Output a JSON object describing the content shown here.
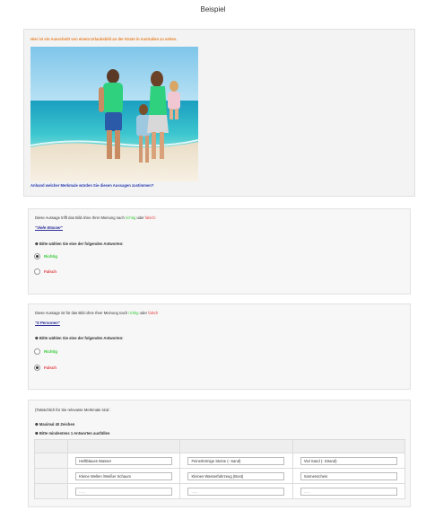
{
  "page": {
    "title": "Beispiel"
  },
  "intro": {
    "text": "Hier ist ein Ausschnitt von einem Urlaubsbild an der Küste in Australien zu sehen.",
    "caption": "Anhand welcher Merkmale würden Sie diesen Aussagen zustimmen?"
  },
  "colors": {
    "orange": "#e8822b",
    "blue": "#2f3fb0",
    "green": "#35c935",
    "red": "#e23a3a"
  },
  "questions": [
    {
      "prompt_prefix": "Diese Aussage trifft das Bild ohne Ihrer Meinung nach",
      "word_true": "richtig",
      "word_or": "oder",
      "word_false": "falsch:",
      "statement": "\"Viele Wasser\"",
      "instruction": "❶ Bitte wählen Sie eine der folgenden Antworten:",
      "options": [
        "Richtig",
        "Falsch"
      ],
      "selected": "Richtig"
    },
    {
      "prompt_prefix": "Diese Aussage ist für das Bild ohne Ihrer Meinung nach",
      "word_true": "richtig",
      "word_or": "oder",
      "word_false": "falsch",
      "statement": "\"5 Personen\"",
      "instruction": "❶ Bitte wählen Sie eine der folgenden Antworten:",
      "options": [
        "Richtig",
        "Falsch"
      ],
      "selected": "Falsch"
    }
  ],
  "features": {
    "prompt": "(Tatsächlich für Sie relevante Merkmale sind :",
    "max_note": "❶ Maximal 40 Zeichen",
    "min_note": "❶ Bitte mindestens 1 Antworten ausfüllen",
    "rows": [
      [
        "Helltblaues Wasser",
        "Feinerkörnige Steine (- Sand)",
        "Viel Sand (- Strand)"
      ],
      [
        "Kleine Wellen /Weißer Schaum",
        "Kleines Wasserfahrzeug (Boot)",
        "Sonnenschein"
      ],
      [
        "",
        "",
        ""
      ]
    ],
    "placeholder": "......"
  }
}
